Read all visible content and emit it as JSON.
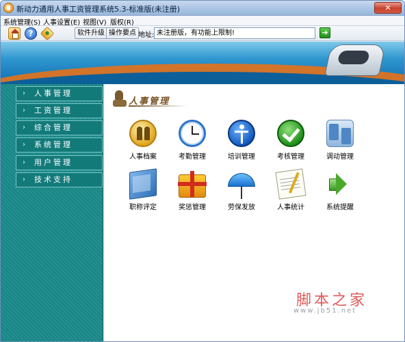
{
  "window": {
    "title": "新动力通用人事工资管理系统5.3-标准版(未注册)",
    "close_label": "✕"
  },
  "menu": [
    {
      "label": "系统管理(S)"
    },
    {
      "label": "人事设置(E)"
    },
    {
      "label": "视图(V)"
    },
    {
      "label": "版权(R)"
    }
  ],
  "toolbar": {
    "upgrade_label": "软件升级",
    "tips_label": "操作要点",
    "address_label": "地址:",
    "address_value": "未注册版，有功能上限制!",
    "go_label": "➔",
    "help_label": "?"
  },
  "sidebar": {
    "items": [
      {
        "label": "人事管理"
      },
      {
        "label": "工资管理"
      },
      {
        "label": "综合管理"
      },
      {
        "label": "系统管理"
      },
      {
        "label": "用户管理"
      },
      {
        "label": "技术支持"
      }
    ]
  },
  "main": {
    "section_title": "人事管理",
    "modules": [
      {
        "label": "人事档案",
        "icon": "people-icon"
      },
      {
        "label": "考勤管理",
        "icon": "clock-icon"
      },
      {
        "label": "培训管理",
        "icon": "accessibility-icon"
      },
      {
        "label": "考核管理",
        "icon": "checkmark-icon"
      },
      {
        "label": "调动管理",
        "icon": "transfer-icon"
      },
      {
        "label": "职称评定",
        "icon": "book-icon"
      },
      {
        "label": "奖惩管理",
        "icon": "gift-icon"
      },
      {
        "label": "劳保发放",
        "icon": "umbrella-icon"
      },
      {
        "label": "人事统计",
        "icon": "notes-icon"
      },
      {
        "label": "系统提醒",
        "icon": "speaker-icon"
      }
    ]
  },
  "watermark": {
    "text": "脚本之家",
    "url": "www.jb51.net"
  },
  "colors": {
    "sidebar_bg": "#1a8a8a",
    "title_bar": "#a9c4e4",
    "section_title": "#7a5226"
  }
}
